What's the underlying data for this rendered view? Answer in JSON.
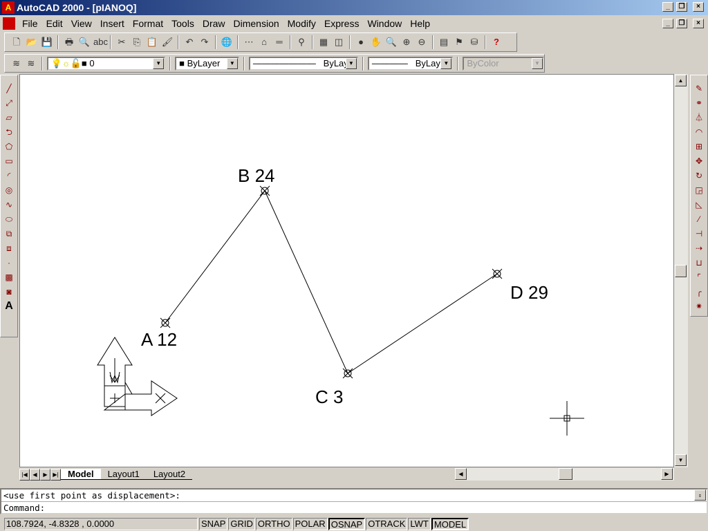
{
  "window": {
    "title": "AutoCAD 2000 - [pIANOQ]"
  },
  "menu": [
    "File",
    "Edit",
    "View",
    "Insert",
    "Format",
    "Tools",
    "Draw",
    "Dimension",
    "Modify",
    "Express",
    "Window",
    "Help"
  ],
  "properties": {
    "layer": "0",
    "color": "ByLayer",
    "linetype": "ByLayer",
    "lineweight": "ByLayer",
    "plotstyle": "ByColor"
  },
  "drawing": {
    "points": [
      {
        "label": "A 12"
      },
      {
        "label": "B 24"
      },
      {
        "label": "C 3"
      },
      {
        "label": "D 29"
      }
    ],
    "ucs": {
      "x": "X",
      "y": "Y",
      "w": "W"
    }
  },
  "tabs": [
    "Model",
    "Layout1",
    "Layout2"
  ],
  "command": {
    "history": "<use first point as displacement>:",
    "prompt": "Command:"
  },
  "status": {
    "coords": "108.7924, -4.8328 , 0.0000",
    "toggles": [
      {
        "label": "SNAP",
        "on": false
      },
      {
        "label": "GRID",
        "on": false
      },
      {
        "label": "ORTHO",
        "on": false
      },
      {
        "label": "POLAR",
        "on": false
      },
      {
        "label": "OSNAP",
        "on": true
      },
      {
        "label": "OTRACK",
        "on": false
      },
      {
        "label": "LWT",
        "on": false
      },
      {
        "label": "MODEL",
        "on": true
      }
    ]
  }
}
